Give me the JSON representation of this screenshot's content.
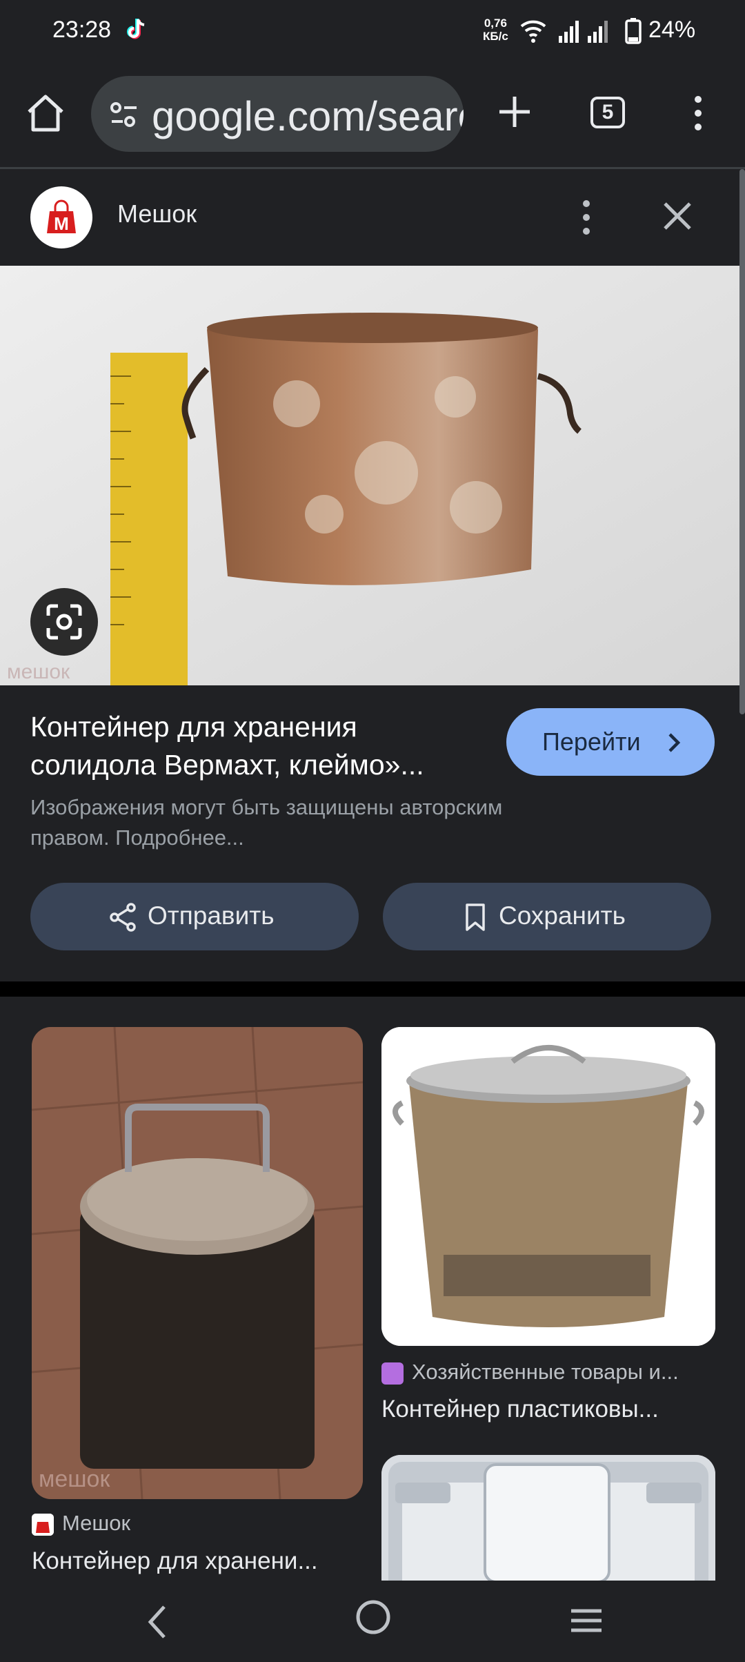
{
  "status_bar": {
    "time": "23:28",
    "net_speed_line1": "0,76",
    "net_speed_line2": "КБ/с",
    "battery": "24%",
    "icons": [
      "tiktok-icon",
      "wifi-icon",
      "signal-icon",
      "signal-icon-2",
      "battery-icon"
    ]
  },
  "toolbar": {
    "url": "google.com/search",
    "tab_count": "5",
    "icons": [
      "home-icon",
      "site-settings-icon",
      "new-tab-icon",
      "tabs-icon",
      "menu-icon"
    ]
  },
  "source": {
    "name": "Мешок",
    "logo_letter": "M",
    "accent": "#d81e1e"
  },
  "result": {
    "title_line1": "Контейнер для хранения",
    "title_line2": "солидола Вермахт, клеймо»...",
    "go_label": "Перейти",
    "copyright_line1": "Изображения могут быть защищены авторским",
    "copyright_line2": "правом. Подробнее..."
  },
  "actions": {
    "share_label": "Отправить",
    "save_label": "Сохранить"
  },
  "related": [
    {
      "source": "Мешок",
      "caption": "Контейнер для хранени..."
    },
    {
      "source": "Хозяйственные товары и...",
      "caption": "Контейнер пластиковы..."
    },
    {
      "source": "",
      "caption": ""
    }
  ],
  "colors": {
    "background": "#202124",
    "pill": "#394457",
    "go_button": "#8ab4f8"
  }
}
